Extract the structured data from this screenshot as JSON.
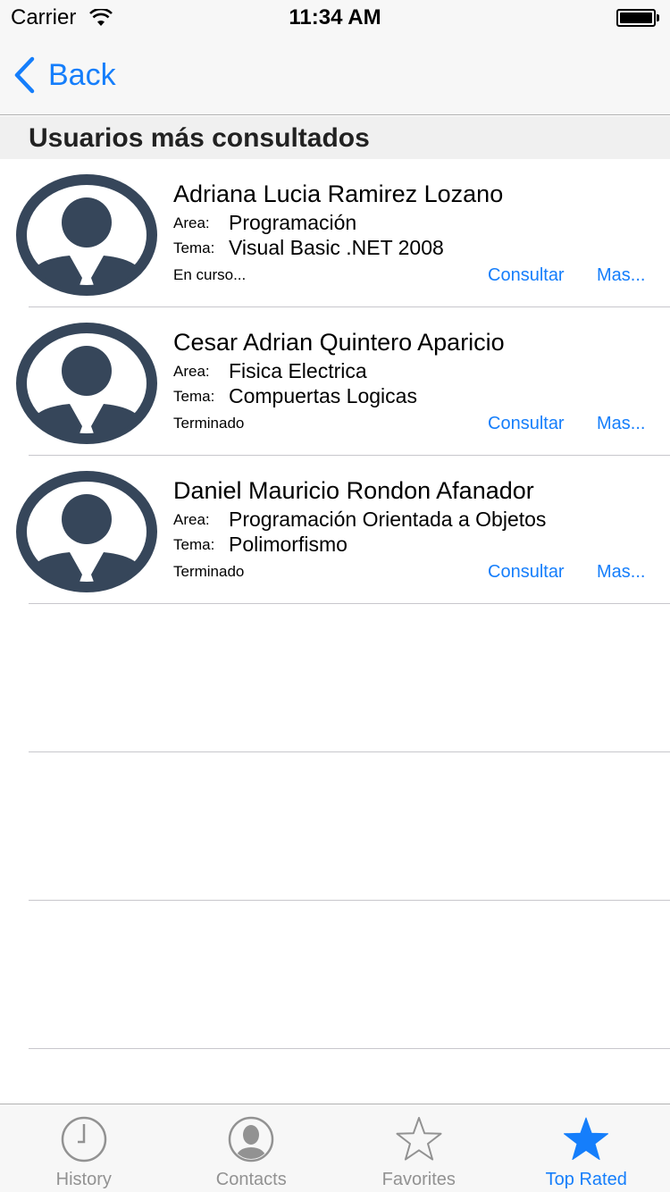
{
  "status_bar": {
    "carrier": "Carrier",
    "time": "11:34 AM"
  },
  "nav": {
    "back_label": "Back"
  },
  "section": {
    "title": "Usuarios más consultados"
  },
  "labels": {
    "area": "Area:",
    "tema": "Tema:",
    "consultar": "Consultar",
    "mas": "Mas..."
  },
  "users": [
    {
      "name": "Adriana Lucia Ramirez Lozano",
      "area": "Programación",
      "tema": "Visual Basic .NET 2008",
      "status": "En curso..."
    },
    {
      "name": "Cesar Adrian Quintero Aparicio",
      "area": "Fisica Electrica",
      "tema": "Compuertas Logicas",
      "status": "Terminado"
    },
    {
      "name": "Daniel Mauricio Rondon Afanador",
      "area": "Programación Orientada a Objetos",
      "tema": "Polimorfismo",
      "status": "Terminado"
    }
  ],
  "tabs": [
    {
      "label": "History",
      "icon": "clock-icon"
    },
    {
      "label": "Contacts",
      "icon": "contacts-icon"
    },
    {
      "label": "Favorites",
      "icon": "star-outline-icon"
    },
    {
      "label": "Top Rated",
      "icon": "star-filled-icon",
      "active": true
    }
  ],
  "colors": {
    "accent": "#157efb",
    "avatar": "#36465a",
    "inactive": "#929292"
  }
}
